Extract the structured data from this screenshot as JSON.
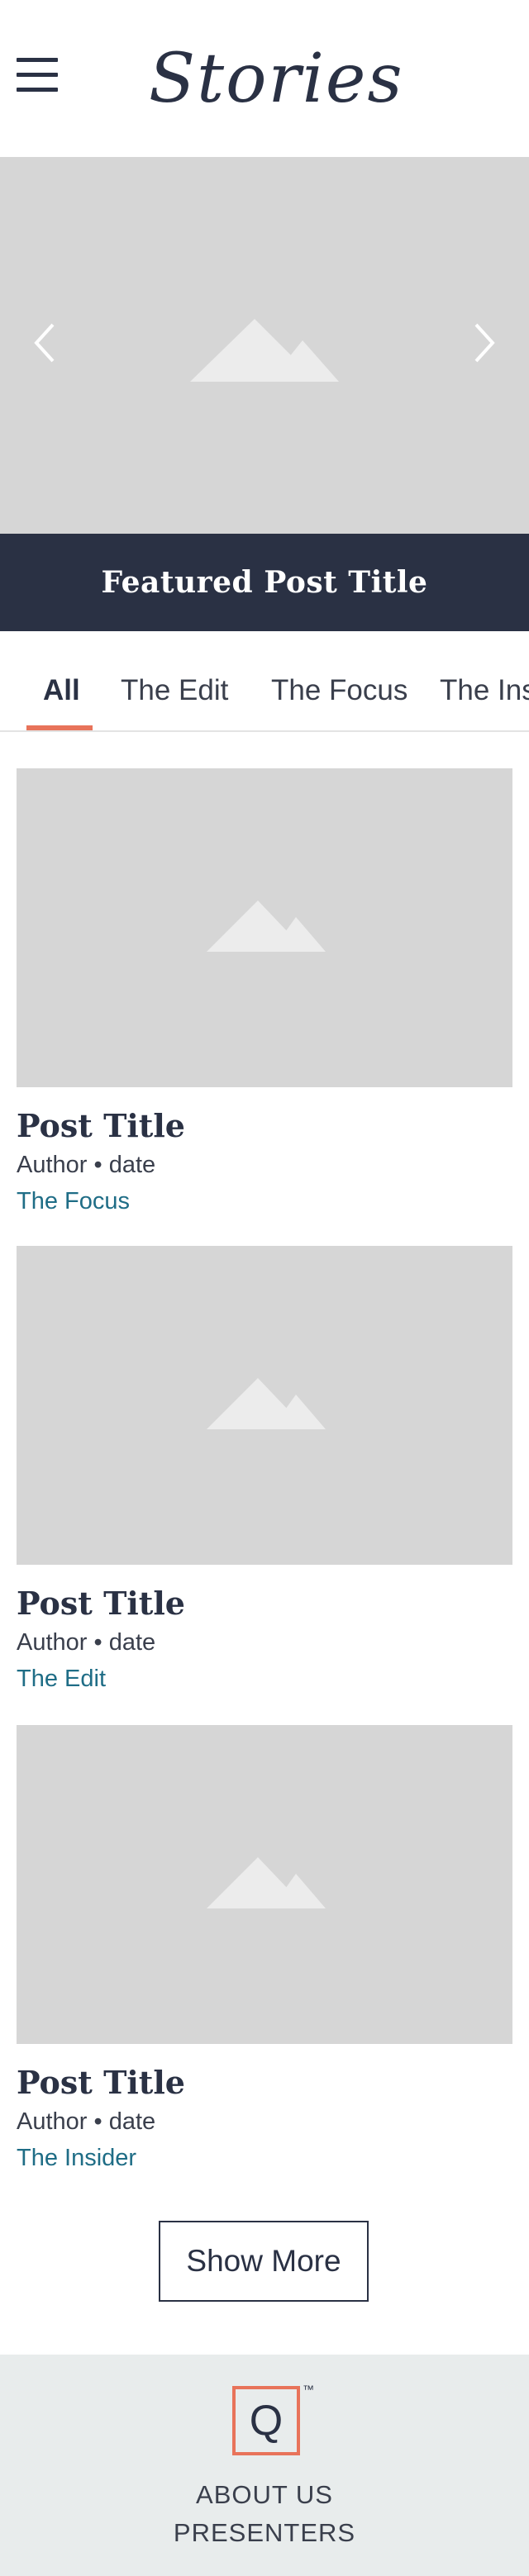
{
  "header": {
    "menu_icon": "hamburger-menu-icon",
    "logo_text": "Stories"
  },
  "hero": {
    "prev_icon": "chevron-left-icon",
    "next_icon": "chevron-right-icon",
    "image_icon": "image-placeholder-icon",
    "featured_title": "Featured Post Title"
  },
  "tabs": {
    "items": [
      {
        "label": "All",
        "active": true
      },
      {
        "label": "The Edit",
        "active": false
      },
      {
        "label": "The Focus",
        "active": false
      },
      {
        "label": "The Insider",
        "active": false
      }
    ],
    "active_color": "#e8735a"
  },
  "posts": [
    {
      "title": "Post Title",
      "meta": "Author • date",
      "category": "The Focus"
    },
    {
      "title": "Post Title",
      "meta": "Author • date",
      "category": "The Edit"
    },
    {
      "title": "Post Title",
      "meta": "Author • date",
      "category": "The Insider"
    }
  ],
  "show_more_label": "Show More",
  "footer": {
    "logo_letter": "Q",
    "tm": "™",
    "links": [
      "ABOUT US",
      "PRESENTERS"
    ]
  },
  "colors": {
    "navy": "#2a3144",
    "accent": "#e8735a",
    "link": "#1f6d86",
    "placeholder": "#d6d6d6",
    "footer_bg": "#e8ecec"
  }
}
